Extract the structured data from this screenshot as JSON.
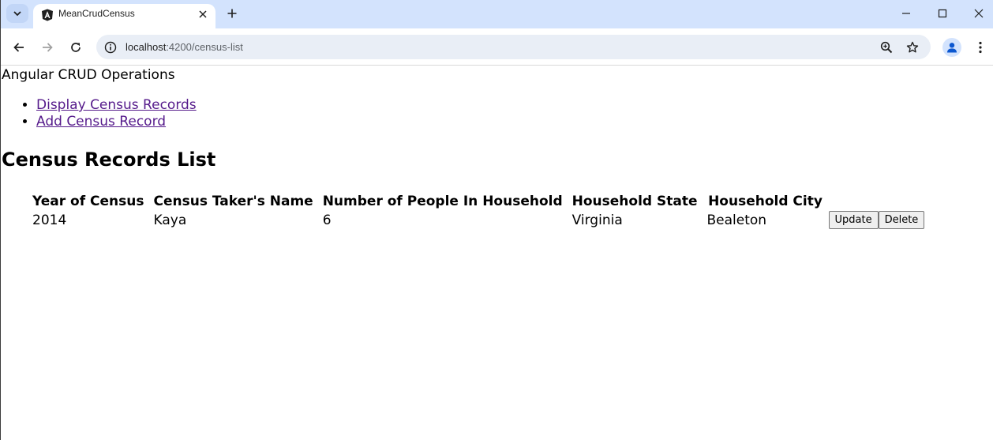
{
  "browser": {
    "tab": {
      "title": "MeanCrudCensus"
    },
    "address": {
      "host": "localhost",
      "path": ":4200/census-list"
    }
  },
  "app": {
    "header": "Angular CRUD Operations",
    "nav": [
      {
        "label": "Display Census Records"
      },
      {
        "label": "Add Census Record"
      }
    ],
    "page_title": "Census Records List",
    "table": {
      "columns": [
        "Year of Census",
        "Census Taker's Name",
        "Number of People In Household",
        "Household State",
        "Household City"
      ],
      "rows": [
        {
          "year": "2014",
          "taker": "Kaya",
          "people": "6",
          "state": "Virginia",
          "city": "Bealeton"
        }
      ],
      "actions": {
        "update": "Update",
        "delete": "Delete"
      }
    }
  },
  "icons": {
    "tab_search": "chevron-down-icon",
    "favicon": "angular-icon",
    "tab_close": "close-icon",
    "new_tab": "plus-icon",
    "minimize": "minimize-icon",
    "maximize": "maximize-icon",
    "close_window": "close-icon",
    "back": "arrow-left-icon",
    "forward": "arrow-right-icon",
    "reload": "reload-icon",
    "site_info": "info-icon",
    "zoom": "zoom-icon",
    "bookmark": "star-icon",
    "profile": "person-icon",
    "menu": "kebab-menu-icon"
  },
  "colors": {
    "tabstrip_bg": "#d3e3fd",
    "omnibox_bg": "#e9eef6",
    "link_visited": "#551a8b",
    "profile_icon": "#0b57d0"
  }
}
